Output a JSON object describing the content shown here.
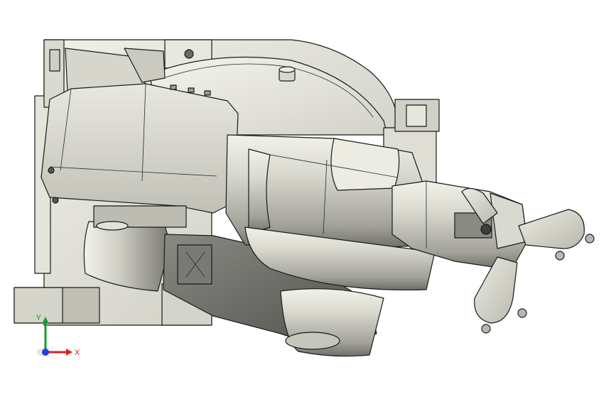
{
  "viewport": {
    "background": "#ffffff",
    "model": "robot-arm-assembly",
    "view_orientation": "top"
  },
  "colors": {
    "part_light": "#e6e6dc",
    "part_mid": "#c9c9be",
    "part_dark": "#8f8f87",
    "part_shadow": "#5e5e5a",
    "edge": "#1a1a1a"
  },
  "triad": {
    "x_label": "X",
    "y_label": "Y",
    "x_color": "#e02020",
    "y_color": "#10a030",
    "z_color": "#2040e0"
  }
}
